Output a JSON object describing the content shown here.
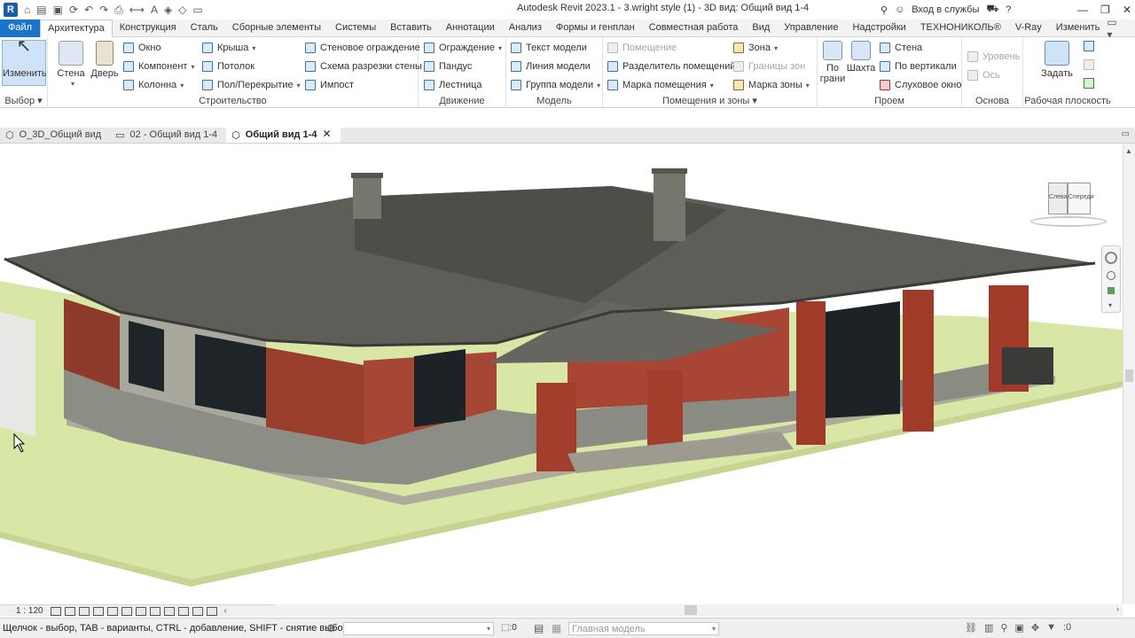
{
  "titlebar": {
    "title": "Autodesk Revit 2023.1 - 3.wright style (1) - 3D вид: Общий вид 1-4",
    "login_label": "Вход в службы",
    "app_logo_letter": "R",
    "controls": {
      "minimize": "—",
      "restore": "❐",
      "close": "✕"
    }
  },
  "ribbon_tabs": [
    {
      "label": "Файл"
    },
    {
      "label": "Архитектура"
    },
    {
      "label": "Конструкция"
    },
    {
      "label": "Сталь"
    },
    {
      "label": "Сборные элементы"
    },
    {
      "label": "Системы"
    },
    {
      "label": "Вставить"
    },
    {
      "label": "Аннотации"
    },
    {
      "label": "Анализ"
    },
    {
      "label": "Формы и генплан"
    },
    {
      "label": "Совместная работа"
    },
    {
      "label": "Вид"
    },
    {
      "label": "Управление"
    },
    {
      "label": "Надстройки"
    },
    {
      "label": "ТЕХНОНИКОЛЬ®"
    },
    {
      "label": "V-Ray"
    },
    {
      "label": "Изменить"
    }
  ],
  "ribbon": {
    "select": {
      "title": "Выбор",
      "modify": "Изменить"
    },
    "build": {
      "title": "Строительство",
      "wall": "Стена",
      "door": "Дверь",
      "window": "Окно",
      "component": "Компонент",
      "column": "Колонна",
      "roof": "Крыша",
      "ceiling": "Потолок",
      "floor": "Пол/Перекрытие",
      "curtain_wall": "Стеновое ограждение",
      "curtain_grid": "Схема разрезки стены",
      "mullion": "Импост"
    },
    "circulation": {
      "title": "Движение",
      "railing": "Ограждение",
      "ramp": "Пандус",
      "stair": "Лестница"
    },
    "model": {
      "title": "Модель",
      "model_text": "Текст модели",
      "model_line": "Линия модели",
      "model_group": "Группа модели"
    },
    "rooms": {
      "title": "Помещения и зоны",
      "room": "Помещение",
      "room_separator": "Разделитель помещений",
      "room_tag": "Марка помещения",
      "area": "Зона",
      "area_boundary": "Границы зон",
      "area_tag": "Марка зоны"
    },
    "opening": {
      "title": "Проем",
      "by_face": "По грани",
      "shaft": "Шахта",
      "wall": "Стена",
      "vertical": "По вертикали",
      "dormer": "Слуховое окно"
    },
    "datum": {
      "title": "Основа",
      "level": "Уровень",
      "grid": "Ось"
    },
    "workplane": {
      "title": "Рабочая плоскость",
      "set": "Задать"
    }
  },
  "view_tabs": [
    {
      "label": "О_3D_Общий вид"
    },
    {
      "label": "02 - Общий вид 1-4"
    },
    {
      "label": "Общий вид 1-4"
    }
  ],
  "viewcube": {
    "face_left": "Слева",
    "face_front": "Спереди"
  },
  "view_control": {
    "scale": "1 : 120"
  },
  "statusbar": {
    "hint": "Щелчок - выбор, TAB - варианты, CTRL - добавление, SHIFT - снятие выбора.",
    "select_count": ":0",
    "model_placeholder": "Главная модель",
    "filter_count": ":0"
  }
}
